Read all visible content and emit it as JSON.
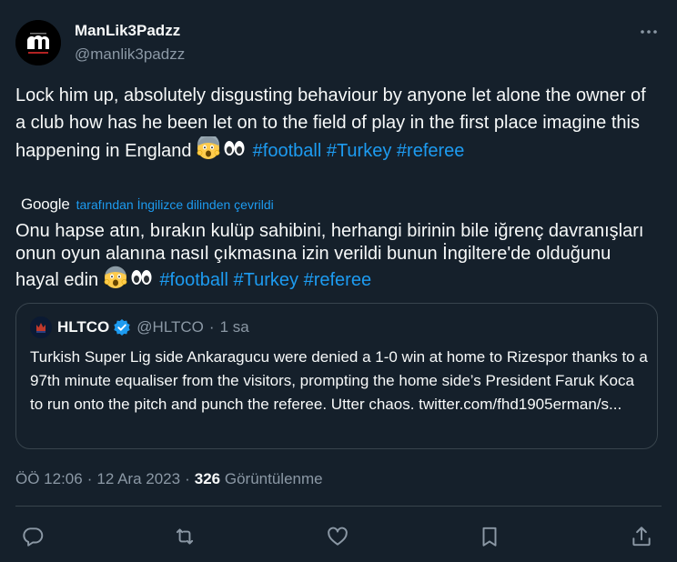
{
  "author": {
    "name": "ManLik3Padzz",
    "handle": "@manlik3padzz",
    "avatar_icon": "manlik3padzz-logo"
  },
  "tweet": {
    "text_main": "Lock him up, absolutely disgusting behaviour by anyone let alone the owner of a club how has he been let on to the field of play in the first place imagine this happening in England",
    "emoji_1": "face-screaming-in-fear",
    "emoji_2": "eyes",
    "hashtags": [
      "#football",
      "#Turkey",
      "#referee"
    ]
  },
  "translation": {
    "provider": "Google",
    "note": "tarafından İngilizce dilinden çevrildi",
    "text": "Onu hapse atın, bırakın kulüp sahibini, herhangi birinin bile iğrenç davranışları onun oyun alanına nasıl çıkmasına izin verildi bunun İngiltere'de olduğunu hayal edin",
    "hashtags": [
      "#football",
      "#Turkey",
      "#referee"
    ]
  },
  "quote": {
    "name": "HLTCO",
    "handle": "@HLTCO",
    "dot": "·",
    "time": "1 sa",
    "verified": true,
    "text": "Turkish Super Lig side Ankaragucu were denied a 1-0 win at home to Rizespor thanks to a 97th minute equaliser from the visitors, prompting the home side’s President Faruk Koca to run onto the pitch and punch the referee. Utter chaos.",
    "link": "twitter.com/fhd1905erman/s..."
  },
  "meta": {
    "time": "ÖÖ 12:06",
    "sep": "·",
    "date": "12 Ara 2023",
    "views_count": "326",
    "views_label": "Görüntülenme"
  },
  "actions": [
    "reply-icon",
    "retweet-icon",
    "like-icon",
    "bookmark-icon",
    "share-icon"
  ],
  "colors": {
    "background": "#15202b",
    "text": "#f7f9f9",
    "secondary": "#8b98a5",
    "accent": "#1d9bf0",
    "border": "#38444d"
  }
}
